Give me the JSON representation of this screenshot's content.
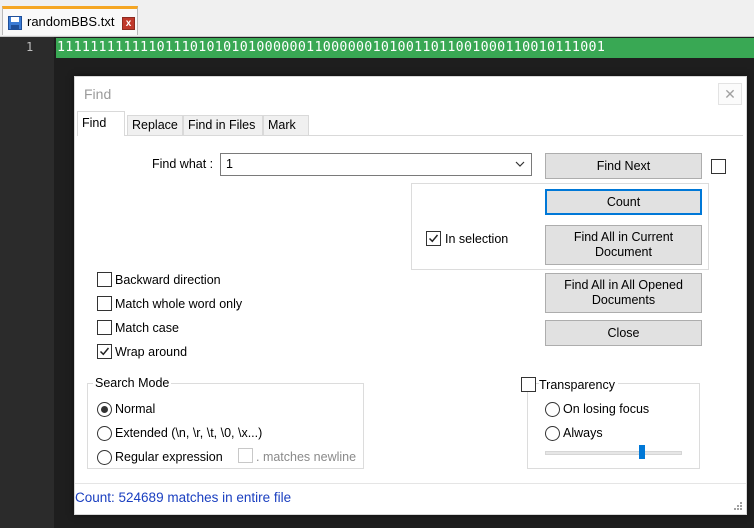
{
  "tab": {
    "filename": "randomBBS.txt",
    "close_glyph": "x"
  },
  "editor": {
    "line_number": "1",
    "content": "111111111111011101010101000000110000001010011011001000110010111001",
    "highlight_color": "#39a854"
  },
  "dialog": {
    "title": "Find",
    "close_glyph": "✕",
    "tabs": [
      "Find",
      "Replace",
      "Find in Files",
      "Mark"
    ],
    "find_what_label": "Find what :",
    "find_what_value": "1",
    "buttons": {
      "find_next": "Find Next",
      "count": "Count",
      "find_all_current": "Find All in Current Document",
      "find_all_opened": "Find All in All Opened Documents",
      "close": "Close"
    },
    "in_selection": {
      "label": "In selection",
      "checked": true
    },
    "options": [
      {
        "label": "Backward direction",
        "checked": false
      },
      {
        "label": "Match whole word only",
        "checked": false
      },
      {
        "label": "Match case",
        "checked": false
      },
      {
        "label": "Wrap around",
        "checked": true
      }
    ],
    "search_mode": {
      "title": "Search Mode",
      "modes": [
        "Normal",
        "Extended (\\n, \\r, \\t, \\0, \\x...)",
        "Regular expression"
      ],
      "selected": "Normal",
      "matches_newline": ". matches newline"
    },
    "transparency": {
      "label": "Transparency",
      "checked": false,
      "options": [
        "On losing focus",
        "Always"
      ],
      "level": 0.7
    },
    "status": "Count: 524689 matches in entire file",
    "accent_color": "#0078d7",
    "status_color": "#1a3fc0"
  }
}
